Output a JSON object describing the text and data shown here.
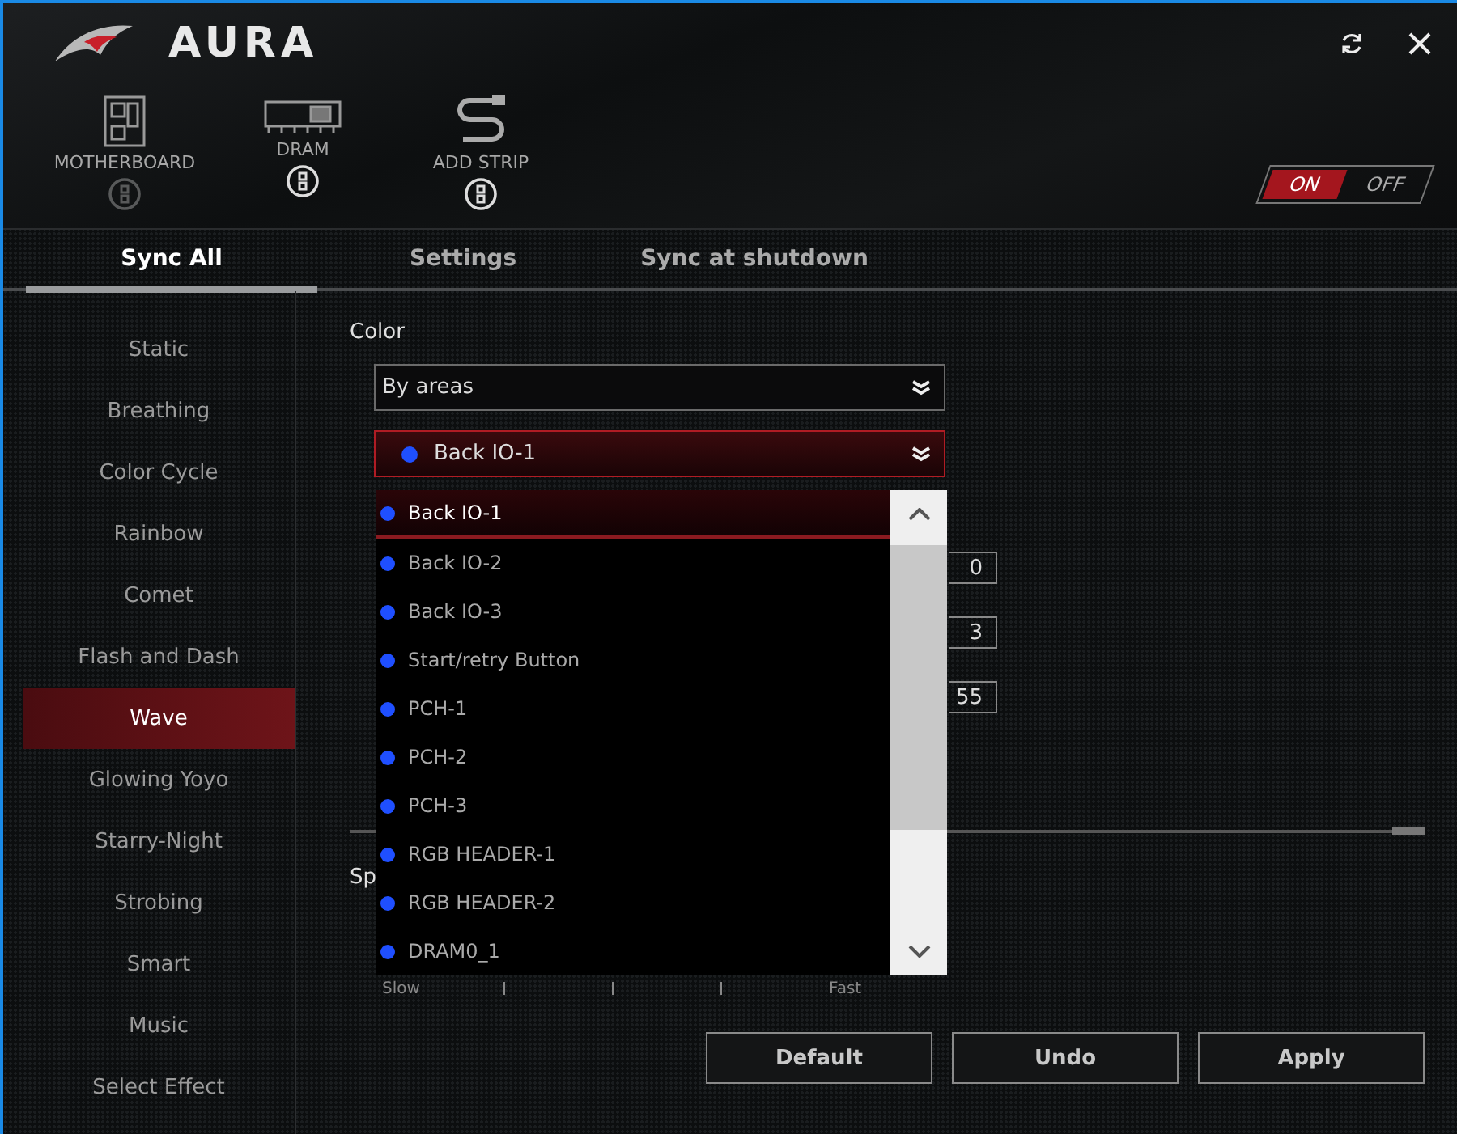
{
  "window": {
    "title": "AURA"
  },
  "devices": [
    {
      "label": "MOTHERBOARD",
      "kind": "motherboard",
      "linked": false
    },
    {
      "label": "DRAM",
      "kind": "dram",
      "linked": true
    },
    {
      "label": "ADD STRIP",
      "kind": "strip",
      "linked": true
    }
  ],
  "power_toggle": [
    {
      "label": "ON",
      "selected": true
    },
    {
      "label": "OFF",
      "selected": false
    }
  ],
  "tabs": [
    {
      "label": "Sync All",
      "selected": true
    },
    {
      "label": "Settings",
      "selected": false
    },
    {
      "label": "Sync at shutdown",
      "selected": false
    }
  ],
  "effects": [
    {
      "label": "Static",
      "selected": false
    },
    {
      "label": "Breathing",
      "selected": false
    },
    {
      "label": "Color Cycle",
      "selected": false
    },
    {
      "label": "Rainbow",
      "selected": false
    },
    {
      "label": "Comet",
      "selected": false
    },
    {
      "label": "Flash and Dash",
      "selected": false
    },
    {
      "label": "Wave",
      "selected": true
    },
    {
      "label": "Glowing Yoyo",
      "selected": false
    },
    {
      "label": "Starry-Night",
      "selected": false
    },
    {
      "label": "Strobing",
      "selected": false
    },
    {
      "label": "Smart",
      "selected": false
    },
    {
      "label": "Music",
      "selected": false
    },
    {
      "label": "Select Effect",
      "selected": false
    }
  ],
  "color": {
    "label": "Color",
    "mode": "By areas",
    "area": {
      "label": "Back IO-1",
      "color": "#1f4fff"
    }
  },
  "area_list": [
    {
      "label": "Back IO-1",
      "color": "#1f4fff",
      "selected": true
    },
    {
      "label": "Back IO-2",
      "color": "#1f4fff",
      "selected": false
    },
    {
      "label": "Back IO-3",
      "color": "#1f4fff",
      "selected": false
    },
    {
      "label": "Start/retry Button",
      "color": "#1f4fff",
      "selected": false
    },
    {
      "label": "PCH-1",
      "color": "#1f4fff",
      "selected": false
    },
    {
      "label": "PCH-2",
      "color": "#1f4fff",
      "selected": false
    },
    {
      "label": "PCH-3",
      "color": "#1f4fff",
      "selected": false
    },
    {
      "label": "RGB HEADER-1",
      "color": "#1f4fff",
      "selected": false
    },
    {
      "label": "RGB HEADER-2",
      "color": "#1f4fff",
      "selected": false
    },
    {
      "label": "DRAM0_1",
      "color": "#1f4fff",
      "selected": false
    }
  ],
  "rgb_values": [
    "0",
    "3",
    "55"
  ],
  "speed": {
    "label": "Sp",
    "min_label": "Slow",
    "max_label": "Fast"
  },
  "buttons": [
    "Default",
    "Undo",
    "Apply"
  ]
}
